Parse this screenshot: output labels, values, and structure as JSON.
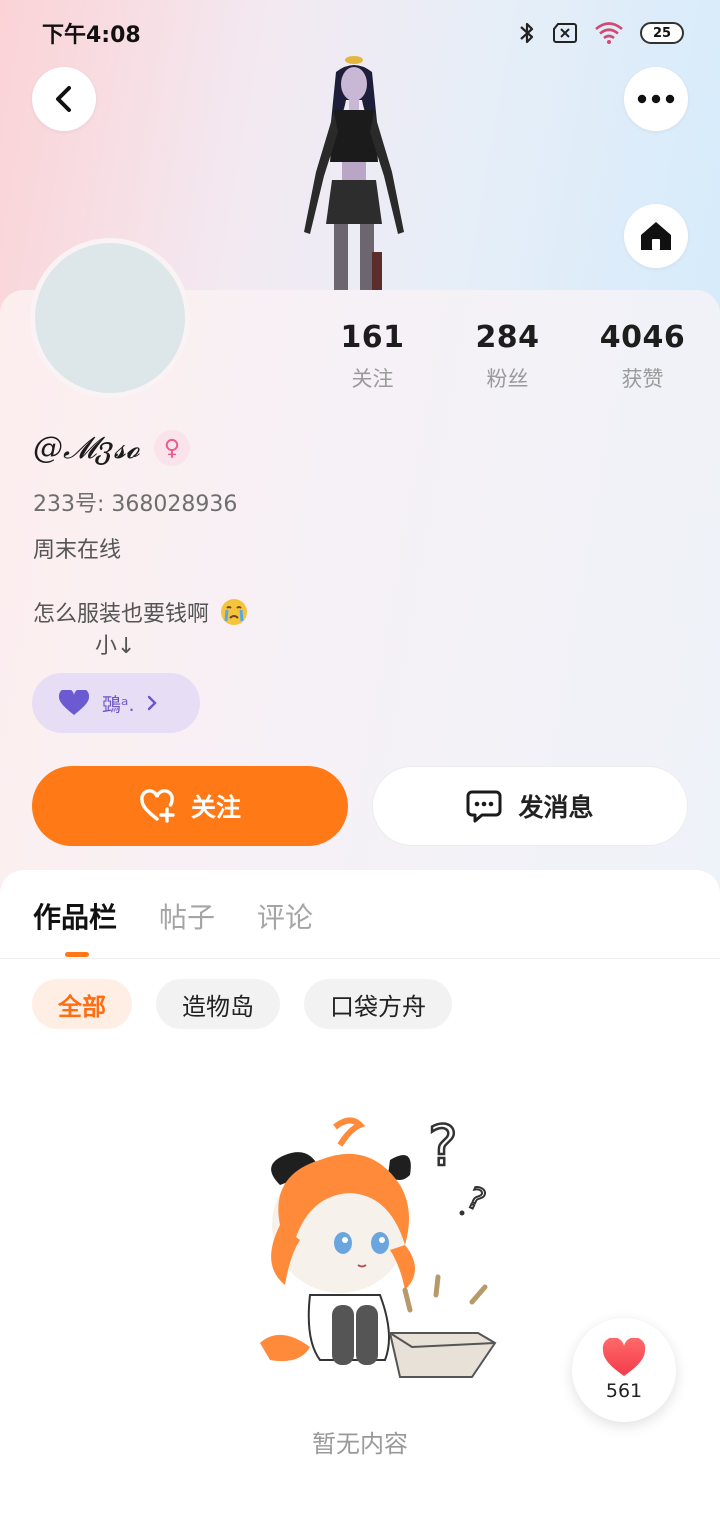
{
  "status_bar": {
    "time": "下午4:08",
    "battery": "25",
    "icons": [
      "bluetooth-icon",
      "sim-off-icon",
      "wifi-icon",
      "battery-icon"
    ]
  },
  "header": {
    "back_icon": "chevron-left-icon",
    "more_icon": "more-dots-icon",
    "home_icon": "home-icon"
  },
  "profile": {
    "stats": [
      {
        "value": "161",
        "label": "关注"
      },
      {
        "value": "284",
        "label": "粉丝"
      },
      {
        "value": "4046",
        "label": "获赞"
      }
    ],
    "nickname": "@𝓜ვ𝓼𝓸",
    "gender_icon": "female-icon",
    "uid": "233号: 368028936",
    "online_status": "周末在线",
    "bio_line1": "怎么服装也要钱啊",
    "bio_line2": "小↓",
    "guild": {
      "name": "鵶ᵃ.",
      "icon": "heart-icon"
    }
  },
  "actions": {
    "follow_label": "关注",
    "message_label": "发消息"
  },
  "tabs": [
    {
      "label": "作品栏",
      "active": true
    },
    {
      "label": "帖子",
      "active": false
    },
    {
      "label": "评论",
      "active": false
    }
  ],
  "filters": [
    {
      "label": "全部",
      "active": true
    },
    {
      "label": "造物岛",
      "active": false
    },
    {
      "label": "口袋方舟",
      "active": false
    }
  ],
  "empty_state": {
    "text": "暂无内容"
  },
  "like_float": {
    "count": "561"
  },
  "colors": {
    "accent": "#ff7a17",
    "guild_bg": "#e7def6",
    "guild_text": "#6c55c9"
  }
}
